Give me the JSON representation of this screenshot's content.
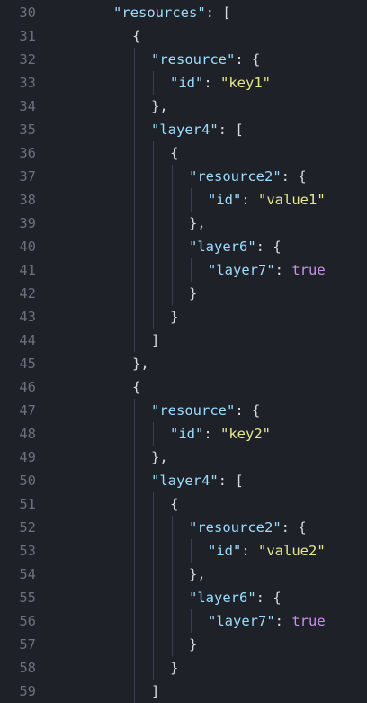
{
  "editor": {
    "colors": {
      "background": "#1e2127",
      "line_number": "#6b717d",
      "key": "#9cdcfe",
      "punctuation": "#d7dae0",
      "string": "#e6e88a",
      "boolean": "#c792ea",
      "indent_guide": "#3a3f4b"
    },
    "lines": [
      {
        "n": "30",
        "indent": 4,
        "tokens": [
          {
            "t": "\"resources\"",
            "c": "key"
          },
          {
            "t": ": [",
            "c": "punct"
          }
        ]
      },
      {
        "n": "31",
        "indent": 5,
        "tokens": [
          {
            "t": "{",
            "c": "punct"
          }
        ]
      },
      {
        "n": "32",
        "indent": 6,
        "tokens": [
          {
            "t": "\"resource\"",
            "c": "key"
          },
          {
            "t": ": {",
            "c": "punct"
          }
        ]
      },
      {
        "n": "33",
        "indent": 7,
        "tokens": [
          {
            "t": "\"id\"",
            "c": "key"
          },
          {
            "t": ": ",
            "c": "punct"
          },
          {
            "t": "\"key1\"",
            "c": "str"
          }
        ]
      },
      {
        "n": "34",
        "indent": 6,
        "tokens": [
          {
            "t": "},",
            "c": "punct"
          }
        ]
      },
      {
        "n": "35",
        "indent": 6,
        "tokens": [
          {
            "t": "\"layer4\"",
            "c": "key"
          },
          {
            "t": ": [",
            "c": "punct"
          }
        ]
      },
      {
        "n": "36",
        "indent": 7,
        "tokens": [
          {
            "t": "{",
            "c": "punct"
          }
        ]
      },
      {
        "n": "37",
        "indent": 8,
        "tokens": [
          {
            "t": "\"resource2\"",
            "c": "key"
          },
          {
            "t": ": {",
            "c": "punct"
          }
        ]
      },
      {
        "n": "38",
        "indent": 9,
        "tokens": [
          {
            "t": "\"id\"",
            "c": "key"
          },
          {
            "t": ": ",
            "c": "punct"
          },
          {
            "t": "\"value1\"",
            "c": "str"
          }
        ]
      },
      {
        "n": "39",
        "indent": 8,
        "tokens": [
          {
            "t": "},",
            "c": "punct"
          }
        ]
      },
      {
        "n": "40",
        "indent": 8,
        "tokens": [
          {
            "t": "\"layer6\"",
            "c": "key"
          },
          {
            "t": ": {",
            "c": "punct"
          }
        ]
      },
      {
        "n": "41",
        "indent": 9,
        "tokens": [
          {
            "t": "\"layer7\"",
            "c": "key"
          },
          {
            "t": ": ",
            "c": "punct"
          },
          {
            "t": "true",
            "c": "bool"
          }
        ]
      },
      {
        "n": "42",
        "indent": 8,
        "tokens": [
          {
            "t": "}",
            "c": "punct"
          }
        ]
      },
      {
        "n": "43",
        "indent": 7,
        "tokens": [
          {
            "t": "}",
            "c": "punct"
          }
        ]
      },
      {
        "n": "44",
        "indent": 6,
        "tokens": [
          {
            "t": "]",
            "c": "punct"
          }
        ]
      },
      {
        "n": "45",
        "indent": 5,
        "tokens": [
          {
            "t": "},",
            "c": "punct"
          }
        ]
      },
      {
        "n": "46",
        "indent": 5,
        "tokens": [
          {
            "t": "{",
            "c": "punct"
          }
        ]
      },
      {
        "n": "47",
        "indent": 6,
        "tokens": [
          {
            "t": "\"resource\"",
            "c": "key"
          },
          {
            "t": ": {",
            "c": "punct"
          }
        ]
      },
      {
        "n": "48",
        "indent": 7,
        "tokens": [
          {
            "t": "\"id\"",
            "c": "key"
          },
          {
            "t": ": ",
            "c": "punct"
          },
          {
            "t": "\"key2\"",
            "c": "str"
          }
        ]
      },
      {
        "n": "49",
        "indent": 6,
        "tokens": [
          {
            "t": "},",
            "c": "punct"
          }
        ]
      },
      {
        "n": "50",
        "indent": 6,
        "tokens": [
          {
            "t": "\"layer4\"",
            "c": "key"
          },
          {
            "t": ": [",
            "c": "punct"
          }
        ]
      },
      {
        "n": "51",
        "indent": 7,
        "tokens": [
          {
            "t": "{",
            "c": "punct"
          }
        ]
      },
      {
        "n": "52",
        "indent": 8,
        "tokens": [
          {
            "t": "\"resource2\"",
            "c": "key"
          },
          {
            "t": ": {",
            "c": "punct"
          }
        ]
      },
      {
        "n": "53",
        "indent": 9,
        "tokens": [
          {
            "t": "\"id\"",
            "c": "key"
          },
          {
            "t": ": ",
            "c": "punct"
          },
          {
            "t": "\"value2\"",
            "c": "str"
          }
        ]
      },
      {
        "n": "54",
        "indent": 8,
        "tokens": [
          {
            "t": "},",
            "c": "punct"
          }
        ]
      },
      {
        "n": "55",
        "indent": 8,
        "tokens": [
          {
            "t": "\"layer6\"",
            "c": "key"
          },
          {
            "t": ": {",
            "c": "punct"
          }
        ]
      },
      {
        "n": "56",
        "indent": 9,
        "tokens": [
          {
            "t": "\"layer7\"",
            "c": "key"
          },
          {
            "t": ": ",
            "c": "punct"
          },
          {
            "t": "true",
            "c": "bool"
          }
        ]
      },
      {
        "n": "57",
        "indent": 8,
        "tokens": [
          {
            "t": "}",
            "c": "punct"
          }
        ]
      },
      {
        "n": "58",
        "indent": 7,
        "tokens": [
          {
            "t": "}",
            "c": "punct"
          }
        ]
      },
      {
        "n": "59",
        "indent": 6,
        "tokens": [
          {
            "t": "]",
            "c": "punct"
          }
        ]
      }
    ]
  }
}
